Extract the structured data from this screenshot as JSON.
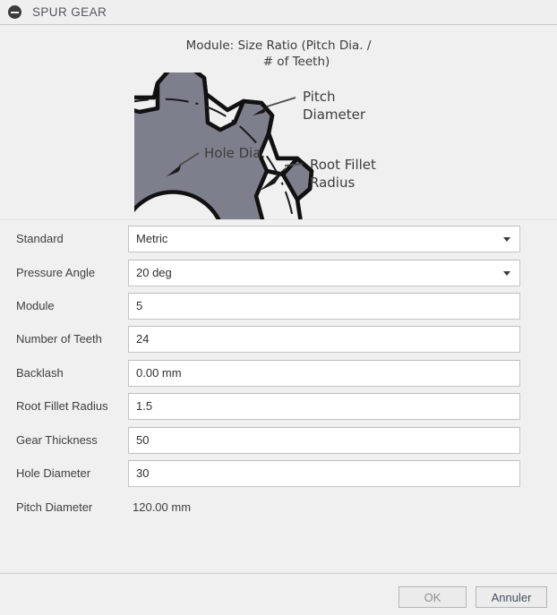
{
  "header": {
    "title": "SPUR GEAR",
    "collapse_icon": "minus-circle-icon"
  },
  "diagram": {
    "caption_line1": "Module: Size Ratio (Pitch Dia. /",
    "caption_line2": "# of Teeth)",
    "annotations": [
      {
        "label_line1": "Pitch",
        "label_line2": "Diameter"
      },
      {
        "label_line1": "Hole Dia.",
        "label_line2": ""
      },
      {
        "label_line1": "Root Fillet",
        "label_line2": "Radius"
      }
    ],
    "gear_fill_color": "#7e7f8c",
    "gear_stroke_color": "#111111",
    "background_color": "#f0f0f0"
  },
  "form": {
    "fields": [
      {
        "label": "Standard",
        "value": "Metric",
        "type": "select"
      },
      {
        "label": "Pressure Angle",
        "value": "20 deg",
        "type": "select"
      },
      {
        "label": "Module",
        "value": "5",
        "type": "text"
      },
      {
        "label": "Number of Teeth",
        "value": "24",
        "type": "text"
      },
      {
        "label": "Backlash",
        "value": "0.00 mm",
        "type": "text"
      },
      {
        "label": "Root Fillet Radius",
        "value": "1.5",
        "type": "text"
      },
      {
        "label": "Gear Thickness",
        "value": "50",
        "type": "text"
      },
      {
        "label": "Hole Diameter",
        "value": "30",
        "type": "text"
      },
      {
        "label": "Pitch Diameter",
        "value": "120.00 mm",
        "type": "readonly"
      }
    ]
  },
  "footer": {
    "ok_label": "OK",
    "cancel_label": "Annuler"
  }
}
